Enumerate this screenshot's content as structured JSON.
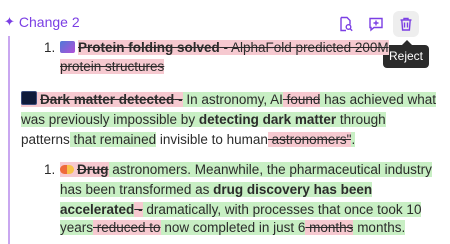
{
  "change": {
    "label": "Change 2"
  },
  "toolbar": {
    "tooltip": "Reject"
  },
  "item1": {
    "number": "1.",
    "del_title": "Protein folding solved",
    "del_rest": " - AlphaFold predicted 200M",
    "del_line2": "protein structures"
  },
  "para": {
    "del_title": "Dark matter detected",
    "del_dash": " -",
    "t1": " In astronomy, AI",
    "d1": " found",
    "t2": " has achieved what",
    "line2_a": "was previously impossible by ",
    "line2_b": "detecting dark matter",
    "line2_c": " through",
    "line3_a": "patterns",
    "line3_b": " that remained",
    "line3_c": " invisible to human",
    "line3_d": " astronomers\"",
    "line3_e": "."
  },
  "item2": {
    "number": "1.",
    "del_title": "Drug",
    "l1_rest": " astronomers. Meanwhile, the pharmaceutical industry",
    "l2_a": "has been transformed as ",
    "l2_b": "drug discovery",
    "l2_c": " has been",
    "l3_a": "accelerated",
    "l3_b": " -",
    "l3_c": " dramatically, with processes that once took 10",
    "l4_a": "years",
    "l4_b": " reduced to",
    "l4_c": " now completed in just 6",
    "l4_d": " months",
    "l4_e": " months."
  },
  "icons": {
    "header": "sparkle-icon",
    "search": "search-document-icon",
    "comment": "comment-add-icon",
    "delete": "trash-icon",
    "emoji1": "dna-emoji",
    "emoji2": "space-emoji",
    "emoji3": "pill-emoji"
  },
  "colors": {
    "accent": "#7b3fe4",
    "deleted_bg": "#f6c9d0",
    "inserted_bg": "#c8efc4",
    "tooltip_bg": "#2b2b2b"
  }
}
